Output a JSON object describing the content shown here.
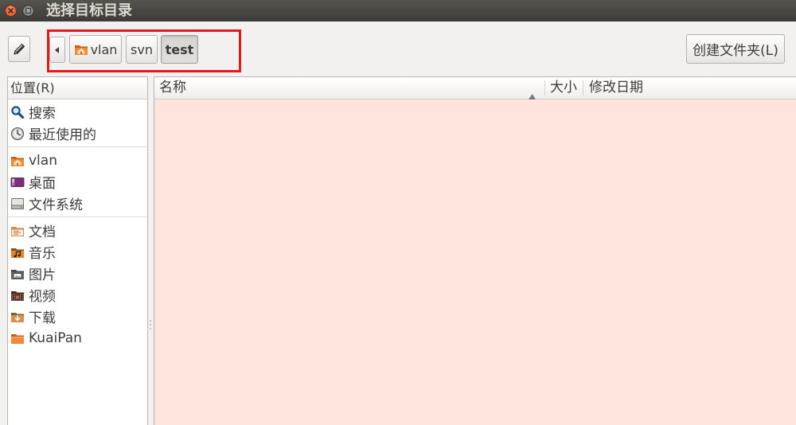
{
  "window": {
    "title": "选择目标目录",
    "close_icon": "close-icon",
    "minimize_icon": "minimize-icon"
  },
  "toolbar": {
    "edit_icon": "pencil-icon",
    "back_icon": "left-arrow-icon",
    "path": [
      {
        "label": "vlan",
        "icon": "home-folder-icon"
      },
      {
        "label": "svn"
      },
      {
        "label": "test",
        "active": true
      }
    ],
    "create_folder_label": "创建文件夹(L)"
  },
  "places": {
    "header": "位置(R)",
    "groups": [
      [
        {
          "label": "搜索",
          "icon": "search-icon"
        },
        {
          "label": "最近使用的",
          "icon": "recent-icon"
        }
      ],
      [
        {
          "label": "vlan",
          "icon": "home-folder-icon"
        },
        {
          "label": "桌面",
          "icon": "desktop-icon"
        },
        {
          "label": "文件系统",
          "icon": "filesystem-icon"
        }
      ],
      [
        {
          "label": "文档",
          "icon": "documents-folder-icon"
        },
        {
          "label": "音乐",
          "icon": "music-folder-icon"
        },
        {
          "label": "图片",
          "icon": "pictures-folder-icon"
        },
        {
          "label": "视频",
          "icon": "videos-folder-icon"
        },
        {
          "label": "下载",
          "icon": "downloads-folder-icon"
        },
        {
          "label": "KuaiPan",
          "icon": "folder-icon"
        }
      ]
    ]
  },
  "file_list": {
    "columns": [
      {
        "label": "名称",
        "sort_icon": "sort-ascending-icon"
      },
      {
        "label": "大小"
      },
      {
        "label": "修改日期"
      }
    ]
  },
  "colors": {
    "titlebar": "#3c3b37",
    "close_button": "#ef6a3b",
    "highlight_box": "#e3191c",
    "window_bg": "#f2f1f0",
    "file_list_bg": "#fde4dd"
  }
}
